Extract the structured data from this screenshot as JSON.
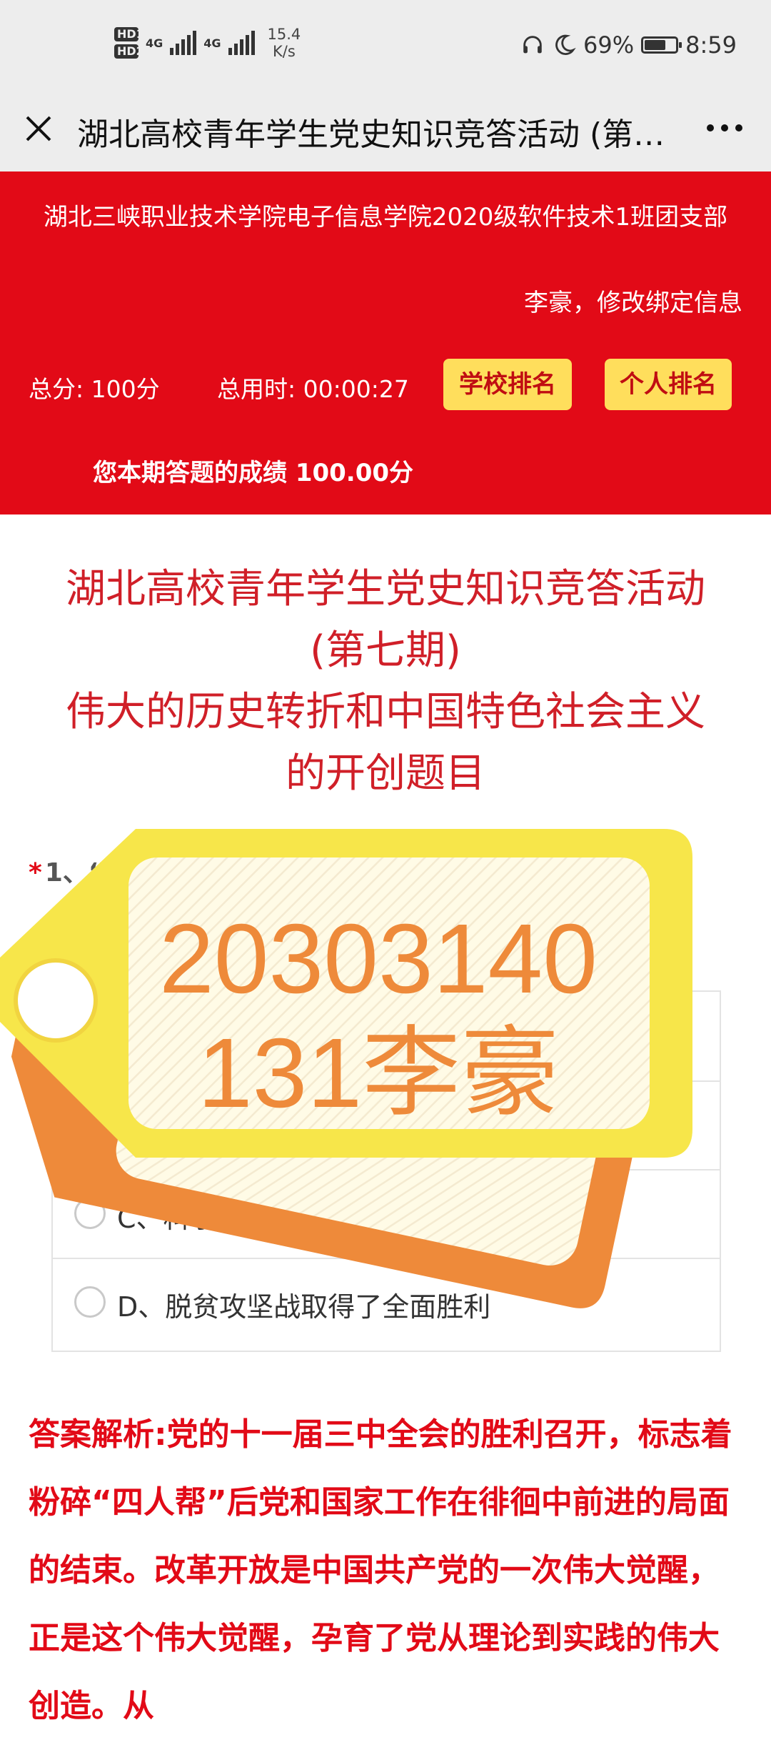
{
  "status_bar": {
    "hd1": "HD1",
    "hd2": "HD2",
    "net1": "4G",
    "net2": "4G",
    "speed_value": "15.4",
    "speed_unit": "K/s",
    "battery_percent": "69%",
    "battery_level": 0.69,
    "time": "8:59"
  },
  "nav": {
    "title": "湖北高校青年学生党史知识竞答活动 (第…"
  },
  "header": {
    "organization": "湖北三峡职业技术学院电子信息学院2020级软件技术1班团支部",
    "user_line": "李豪，修改绑定信息",
    "total_score": "总分: 100分",
    "total_time": "总用时: 00:00:27",
    "school_rank_label": "学校排名",
    "personal_rank_label": "个人排名",
    "result_text": "您本期答题的成绩  100.00分"
  },
  "page_title": {
    "line1": "湖北高校青年学生党史知识竞答活动",
    "line2": "(第七期)",
    "line3": "伟大的历史转折和中国特色社会主义",
    "line4": "的开创题目"
  },
  "question": {
    "required_mark": "*",
    "text": "1、“能够与中国以改革开放中的重大事件”的事",
    "options": [
      {
        "label": "",
        "selected": true
      },
      {
        "label": "",
        "selected": false
      },
      {
        "label": "C、科学发展观",
        "selected": false
      },
      {
        "label": "D、脱贫攻坚战取得了全面胜利",
        "selected": false
      }
    ]
  },
  "answer": {
    "text": "答案解析:党的十一届三中全会的胜利召开，标志着粉碎“四人帮”后党和国家工作在徘徊中前进的局面的结束。改革开放是中国共产党的一次伟大觉醒，正是这个伟大觉醒，孕育了党从理论到实践的伟大创造。从"
  },
  "watermark": {
    "line1": "20303140",
    "line2": "131李豪"
  },
  "colors": {
    "header_red": "#e20a17",
    "title_red": "#d01f28",
    "rank_button": "#ffde5c",
    "watermark_orange": "#ee8a3a",
    "watermark_yellow": "#f7e64a"
  }
}
